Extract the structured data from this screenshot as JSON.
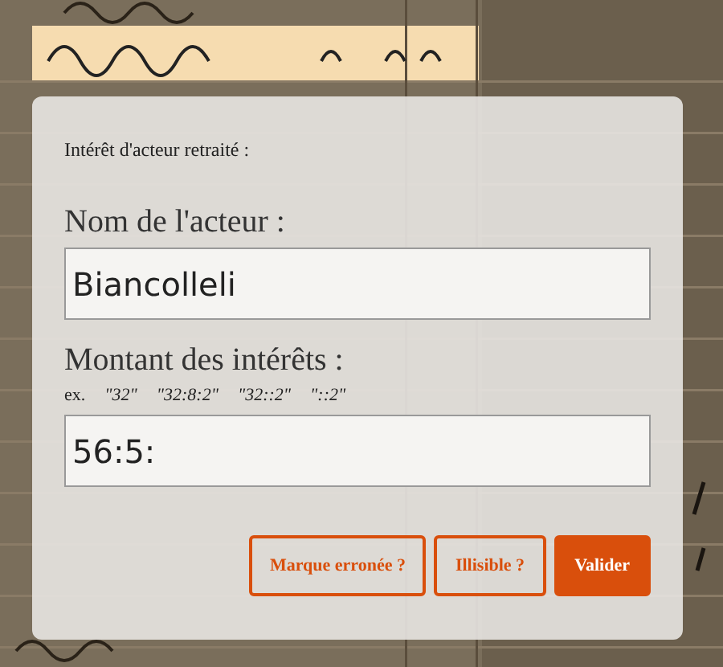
{
  "dialog": {
    "title": "Intérêt d'acteur retraité :",
    "fields": [
      {
        "label": "Nom de l'acteur :",
        "value": "Biancolleli"
      },
      {
        "label": "Montant des intérêts :",
        "value": "56:5:",
        "example": {
          "prefix": "ex.",
          "samples": [
            "\"32\"",
            "\"32:8:2\"",
            "\"32::2\"",
            "\"::2\""
          ]
        }
      }
    ],
    "buttons": [
      {
        "label": "Marque erronée ?",
        "kind": "outline"
      },
      {
        "label": "Illisible ?",
        "kind": "outline"
      },
      {
        "label": "Valider",
        "kind": "primary"
      }
    ]
  }
}
